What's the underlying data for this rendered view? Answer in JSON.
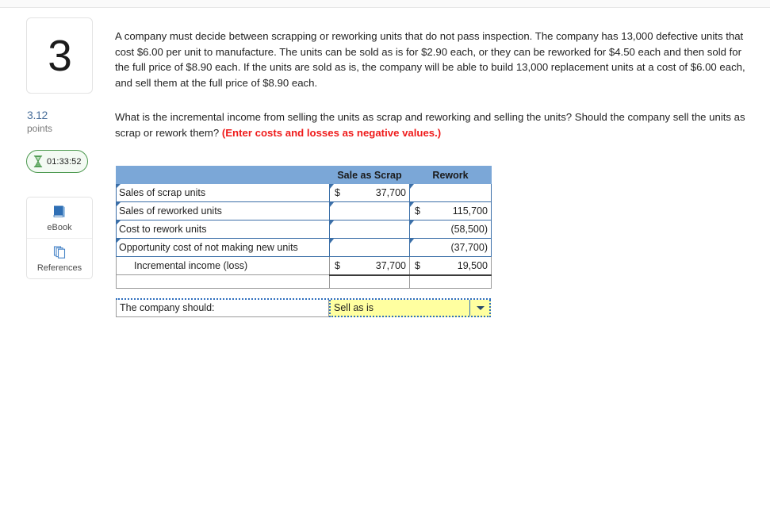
{
  "sidebar": {
    "question_number": "3",
    "points_value": "3.12",
    "points_label": "points",
    "timer": "01:33:52",
    "timer_icon": "hourglass-icon",
    "tools": [
      {
        "label": "eBook",
        "icon": "book-icon"
      },
      {
        "label": "References",
        "icon": "pages-stack-icon"
      }
    ]
  },
  "question": {
    "paragraph1": "A company must decide between scrapping or reworking units that do not pass inspection. The company has 13,000 defective units that cost $6.00 per unit to manufacture. The units can be sold as is for $2.90 each, or they can be reworked for $4.50 each and then sold for the full price of $8.90 each. If the units are sold as is, the company will be able to build 13,000 replacement units at a cost of $6.00 each, and sell them at the full price of $8.90 each.",
    "paragraph2_plain": "What is the incremental income from selling the units as scrap and reworking and selling the units? Should the company sell the units as scrap or rework them? ",
    "paragraph2_emphasis": "(Enter costs and losses as negative values.)"
  },
  "worksheet": {
    "columns": [
      "",
      "Sale as Scrap",
      "Rework"
    ],
    "rows": [
      {
        "label": "Sales of scrap units",
        "scrap_currency": "$",
        "scrap_value": "37,700",
        "rework_currency": "",
        "rework_value": ""
      },
      {
        "label": "Sales of reworked units",
        "scrap_currency": "",
        "scrap_value": "",
        "rework_currency": "$",
        "rework_value": "115,700"
      },
      {
        "label": "Cost to rework units",
        "scrap_currency": "",
        "scrap_value": "",
        "rework_currency": "",
        "rework_value": "(58,500)"
      },
      {
        "label": "Opportunity cost of not making new units",
        "scrap_currency": "",
        "scrap_value": "",
        "rework_currency": "",
        "rework_value": "(37,700)"
      }
    ],
    "total_row": {
      "label": "Incremental income (loss)",
      "scrap_currency": "$",
      "scrap_value": "37,700",
      "rework_currency": "$",
      "rework_value": "19,500"
    },
    "decision": {
      "label": "The company should:",
      "selected": "Sell as is"
    }
  },
  "colors": {
    "header_blue": "#7ba7d7",
    "cell_border_blue": "#3b6fa8",
    "dropdown_yellow": "#ffffa0",
    "dotted_blue": "#2f6fbe",
    "emphasis_red": "#ef1b1b",
    "timer_green": "#4e9a51",
    "points_blue": "#4a6f9b"
  }
}
